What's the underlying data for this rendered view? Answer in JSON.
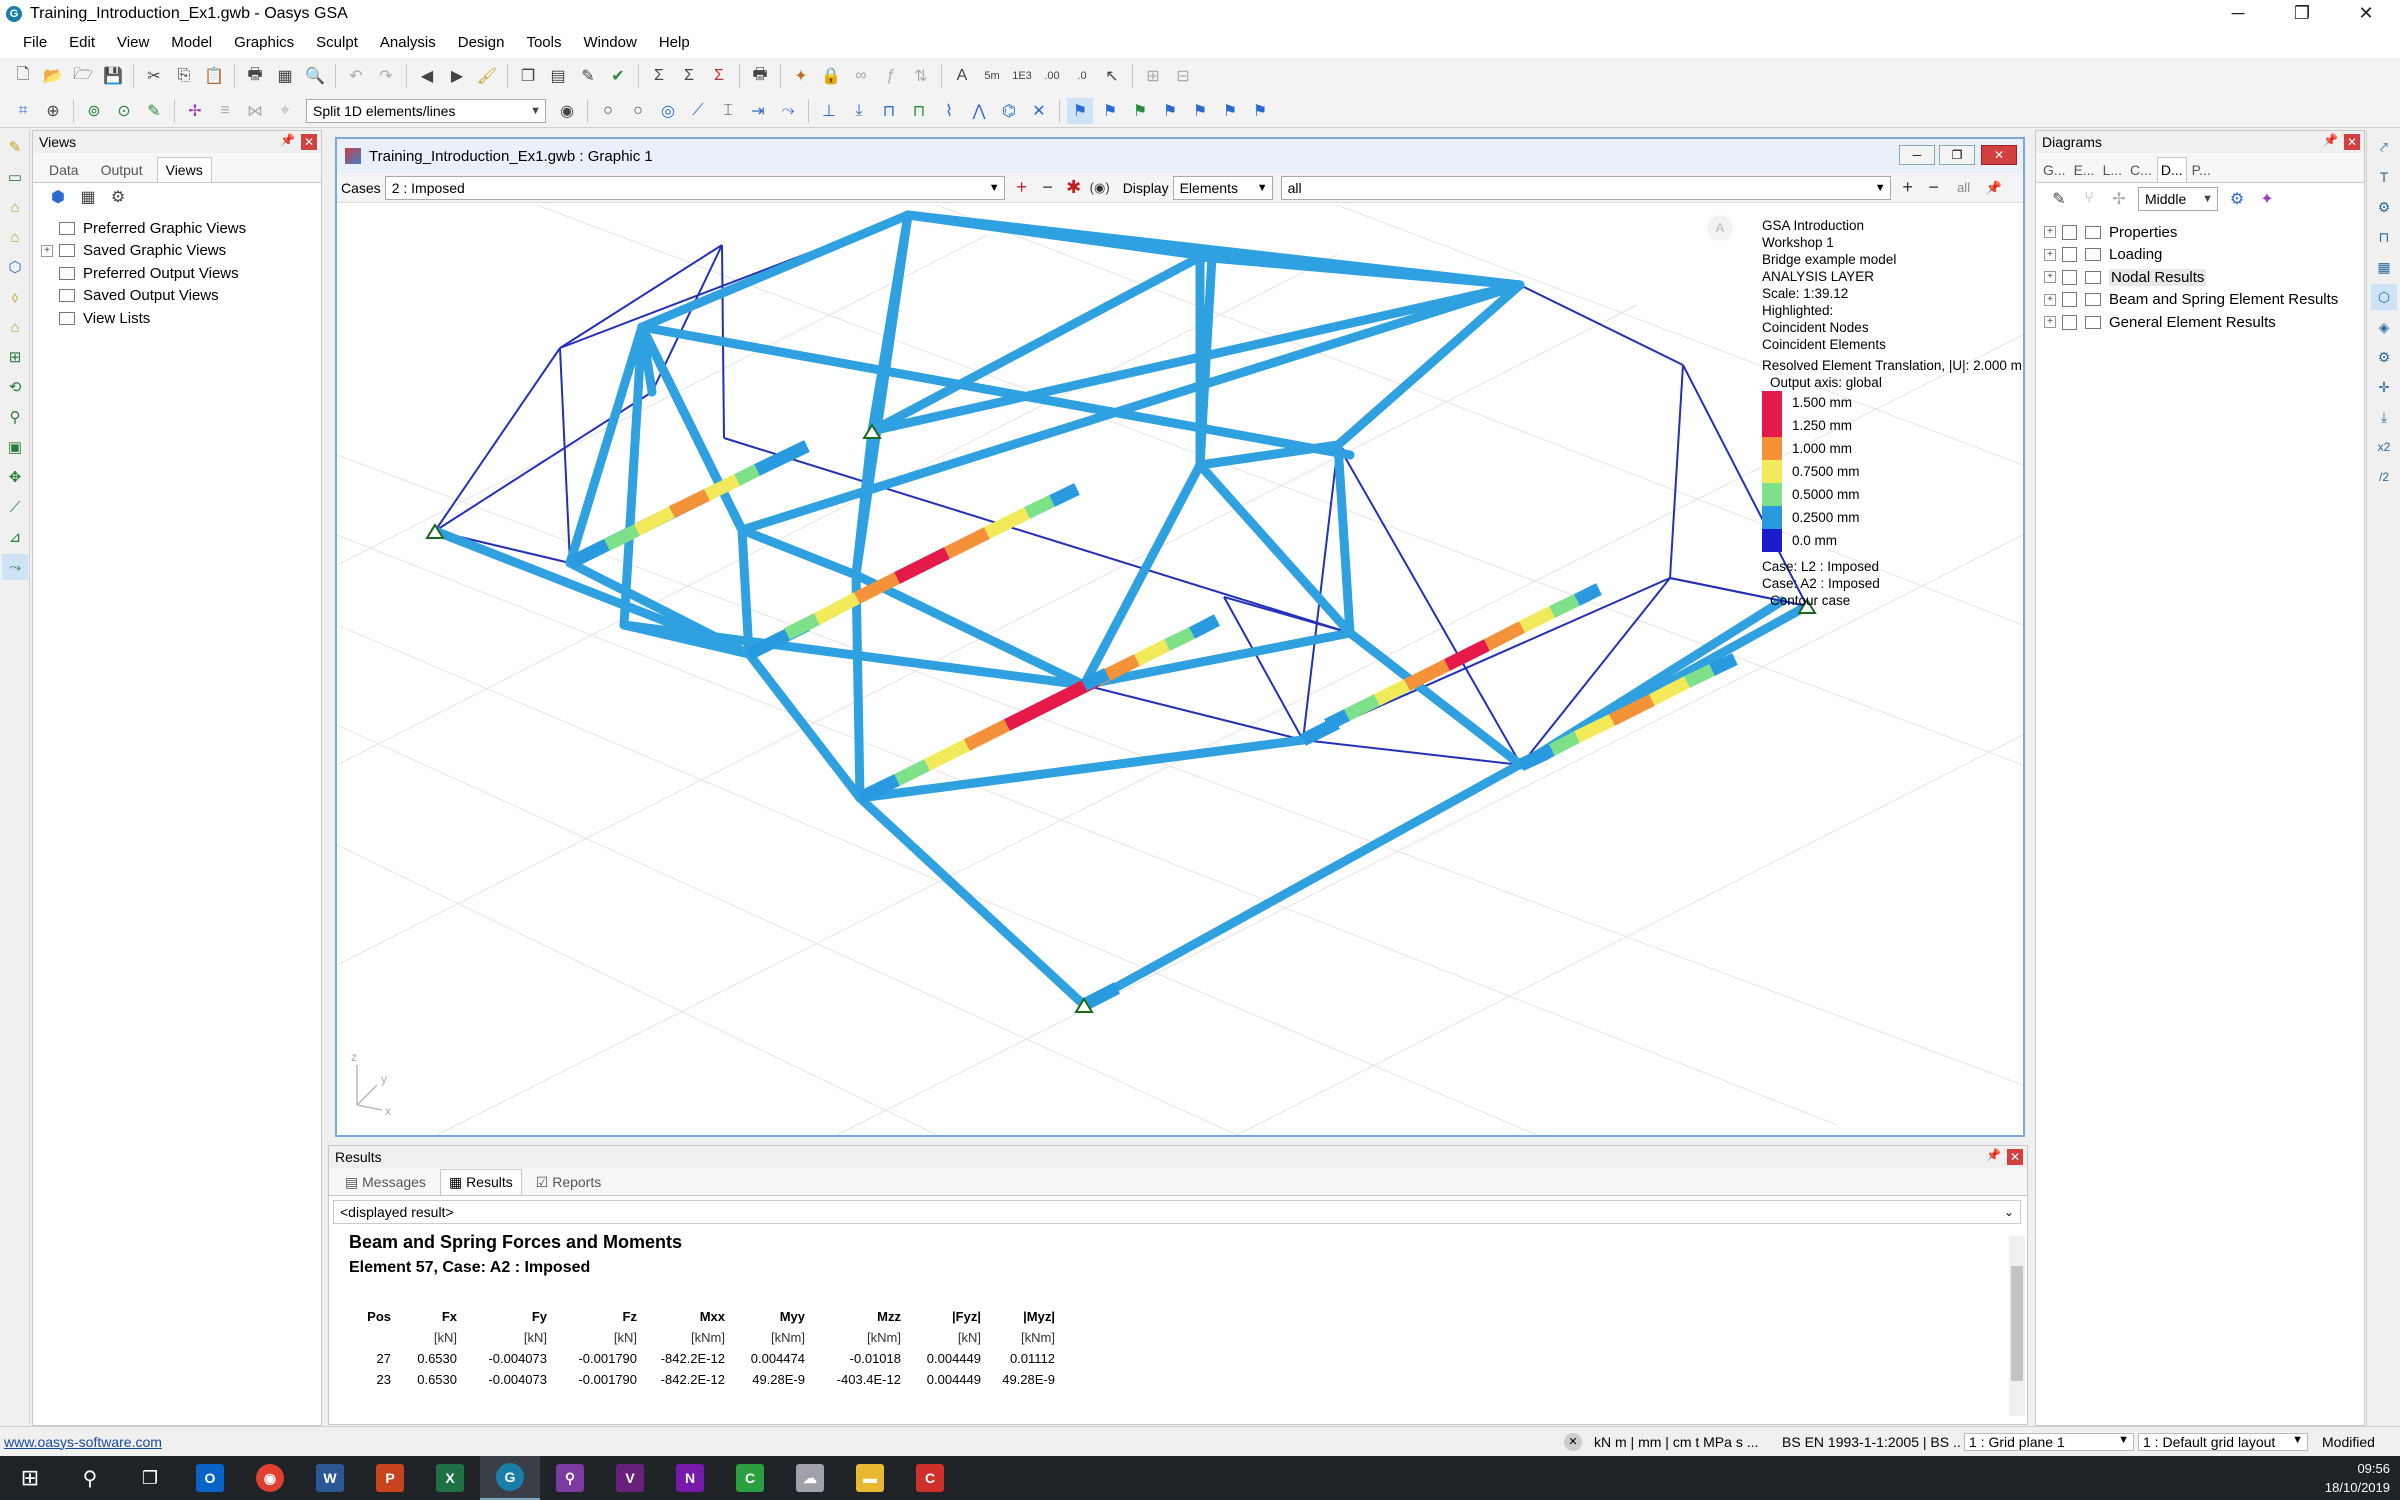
{
  "window": {
    "title": "Training_Introduction_Ex1.gwb - Oasys GSA",
    "minimize": "─",
    "restore": "❐",
    "close": "✕"
  },
  "menu": [
    "File",
    "Edit",
    "View",
    "Model",
    "Graphics",
    "Sculpt",
    "Analysis",
    "Design",
    "Tools",
    "Window",
    "Help"
  ],
  "toolbar2": {
    "split_select": "Split 1D elements/lines"
  },
  "views_panel": {
    "title": "Views",
    "tabs": [
      "Data",
      "Output",
      "Views"
    ],
    "active_tab": "Views",
    "tree": [
      "Preferred Graphic Views",
      "Saved Graphic Views",
      "Preferred Output Views",
      "Saved Output Views",
      "View Lists"
    ]
  },
  "graphic_window": {
    "title": "Training_Introduction_Ex1.gwb : Graphic 1",
    "cases_label": "Cases",
    "cases_value": "2 : Imposed",
    "display_label": "Display",
    "display_value": "Elements",
    "list_value": "all",
    "all_label": "all"
  },
  "legend": {
    "lines_top": [
      "GSA Introduction",
      "Workshop 1",
      "Bridge example model",
      "ANALYSIS LAYER",
      "Scale: 1:39.12",
      "Highlighted:",
      "Coincident Nodes",
      "Coincident Elements",
      "Resolved Element Translation, |U|: 2.000 m",
      "Output axis: global"
    ],
    "scale": [
      {
        "label": "1.500 mm",
        "color": "#e6194b"
      },
      {
        "label": "1.250 mm",
        "color": "#e6194b"
      },
      {
        "label": "1.000 mm",
        "color": "#f4923a"
      },
      {
        "label": "0.7500 mm",
        "color": "#f2ea5a"
      },
      {
        "label": "0.5000 mm",
        "color": "#7fe08a"
      },
      {
        "label": "0.2500 mm",
        "color": "#2a9ae0"
      },
      {
        "label": "0.0 mm",
        "color": "#1c1ccf"
      }
    ],
    "lines_bottom": [
      "Case: L2 : Imposed",
      "Case: A2 : Imposed",
      "Contour case"
    ],
    "badge": "A"
  },
  "diagrams_panel": {
    "title": "Diagrams",
    "tabs": [
      "G...",
      "E...",
      "L...",
      "C...",
      "D...",
      "P..."
    ],
    "position_select": "Middle",
    "tree": [
      "Properties",
      "Loading",
      "Nodal Results",
      "Beam and Spring Element Results",
      "General Element Results"
    ],
    "selected": "Nodal Results"
  },
  "results_panel": {
    "title": "Results",
    "tabs": [
      "Messages",
      "Results",
      "Reports"
    ],
    "active_tab": "Results",
    "dropdown": "<displayed result>",
    "heading": "Beam and Spring Forces and Moments",
    "subheading": "Element 57, Case:  A2 : Imposed",
    "columns": [
      "Pos",
      "Fx",
      "Fy",
      "Fz",
      "Mxx",
      "Myy",
      "Mzz",
      "|Fyz|",
      "|Myz|"
    ],
    "units": [
      "",
      "[kN]",
      "[kN]",
      "[kN]",
      "[kNm]",
      "[kNm]",
      "[kNm]",
      "[kN]",
      "[kNm]"
    ],
    "rows": [
      [
        "27",
        "0.6530",
        "-0.004073",
        "-0.001790",
        "-842.2E-12",
        "0.004474",
        "-0.01018",
        "0.004449",
        "0.01112"
      ],
      [
        "23",
        "0.6530",
        "-0.004073",
        "-0.001790",
        "-842.2E-12",
        "49.28E-9",
        "-403.4E-12",
        "0.004449",
        "49.28E-9"
      ]
    ]
  },
  "statusbar": {
    "link": "www.oasys-software.com",
    "units": "kN  m | mm | cm  t  MPa  s ...",
    "code": "BS EN 1993-1-1:2005 | BS ...",
    "grid_plane": "1 : Grid plane 1",
    "grid_layout": "1 : Default grid layout",
    "state": "Modified"
  },
  "taskbar": {
    "time": "09:56",
    "date": "18/10/2019"
  },
  "axes": {
    "z": "z",
    "y": "y",
    "x": "x"
  }
}
